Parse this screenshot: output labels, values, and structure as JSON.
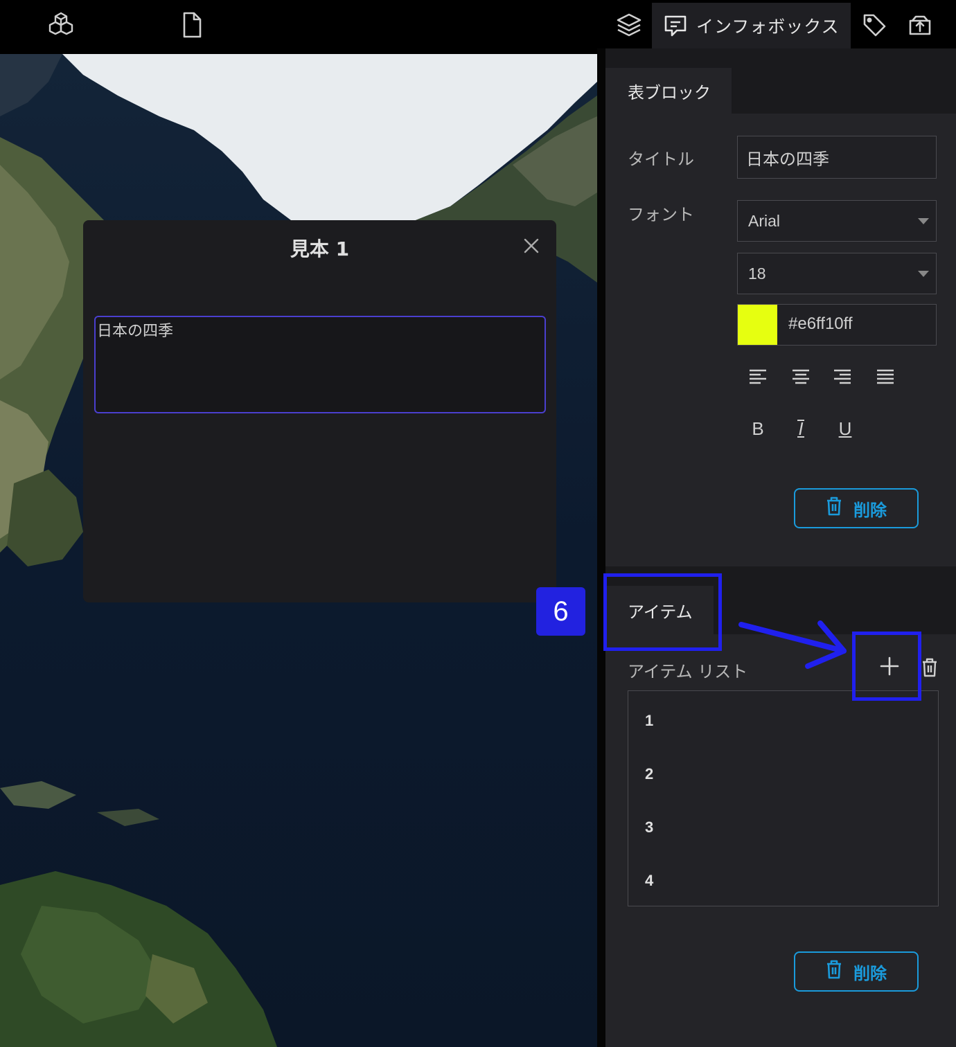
{
  "topbar": {
    "icons": [
      "cube-cluster-icon",
      "file-icon",
      "layers-icon",
      "infobox-icon",
      "tag-icon",
      "export-icon"
    ],
    "active_tab_label": "インフォボックス"
  },
  "dialog": {
    "title": "見本 1",
    "content": "日本の四季"
  },
  "panel": {
    "table_block": {
      "tab_label": "表ブロック",
      "title_label": "タイトル",
      "title_value": "日本の四季",
      "font_label": "フォント",
      "font_family": "Arial",
      "font_size": "18",
      "color_hex": "#e6ff10ff",
      "color_swatch": "#e6ff10",
      "bold_label": "B",
      "italic_label": "I",
      "underline_label": "U",
      "delete_label": "削除"
    },
    "items": {
      "tab_label": "アイテム",
      "list_label": "アイテム リスト",
      "list": [
        "1",
        "2",
        "3",
        "4"
      ],
      "delete_label": "削除"
    }
  },
  "annotation": {
    "step_number": "6",
    "highlight_color": "#2020ee"
  },
  "colors": {
    "accent": "#1a9bdc",
    "panel_bg": "#242428",
    "dialog_border": "#4a3fcf"
  }
}
